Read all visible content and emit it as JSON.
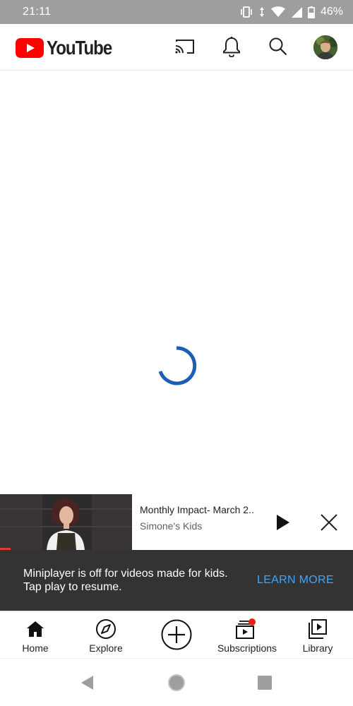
{
  "status_bar": {
    "time": "21:11",
    "battery": "46%",
    "icons": [
      "vibrate-icon",
      "data-arrows-icon",
      "wifi-icon",
      "cell-signal-icon",
      "battery-icon"
    ]
  },
  "app_bar": {
    "logo_text": "YouTube",
    "icons": [
      "cast-icon",
      "bell-icon",
      "search-icon",
      "avatar"
    ]
  },
  "content": {
    "state": "loading",
    "spinner_color": "#1a5fb4"
  },
  "miniplayer": {
    "title": "Monthly Impact- March 2..",
    "channel": "Simone's Kids",
    "progress": 0.08,
    "play_icon": "play-icon",
    "close_icon": "close-icon"
  },
  "snackbar": {
    "message": "Miniplayer is off for videos made for kids. Tap play to resume.",
    "action": "LEARN MORE",
    "action_color": "#3ea6ff"
  },
  "bottom_nav": {
    "items": [
      {
        "label": "Home",
        "icon": "home-icon"
      },
      {
        "label": "Explore",
        "icon": "compass-icon"
      },
      {
        "label": "",
        "icon": "create-plus-icon"
      },
      {
        "label": "Subscriptions",
        "icon": "subscriptions-icon"
      },
      {
        "label": "Library",
        "icon": "library-icon"
      }
    ],
    "notification_dot_color": "#e62117"
  },
  "system_nav": {
    "buttons": [
      "back-icon",
      "home-circle-icon",
      "recents-icon"
    ]
  },
  "colors": {
    "brand_red": "#ff0000",
    "status_bar": "#9e9e9e",
    "snackbar_bg": "#333333"
  }
}
